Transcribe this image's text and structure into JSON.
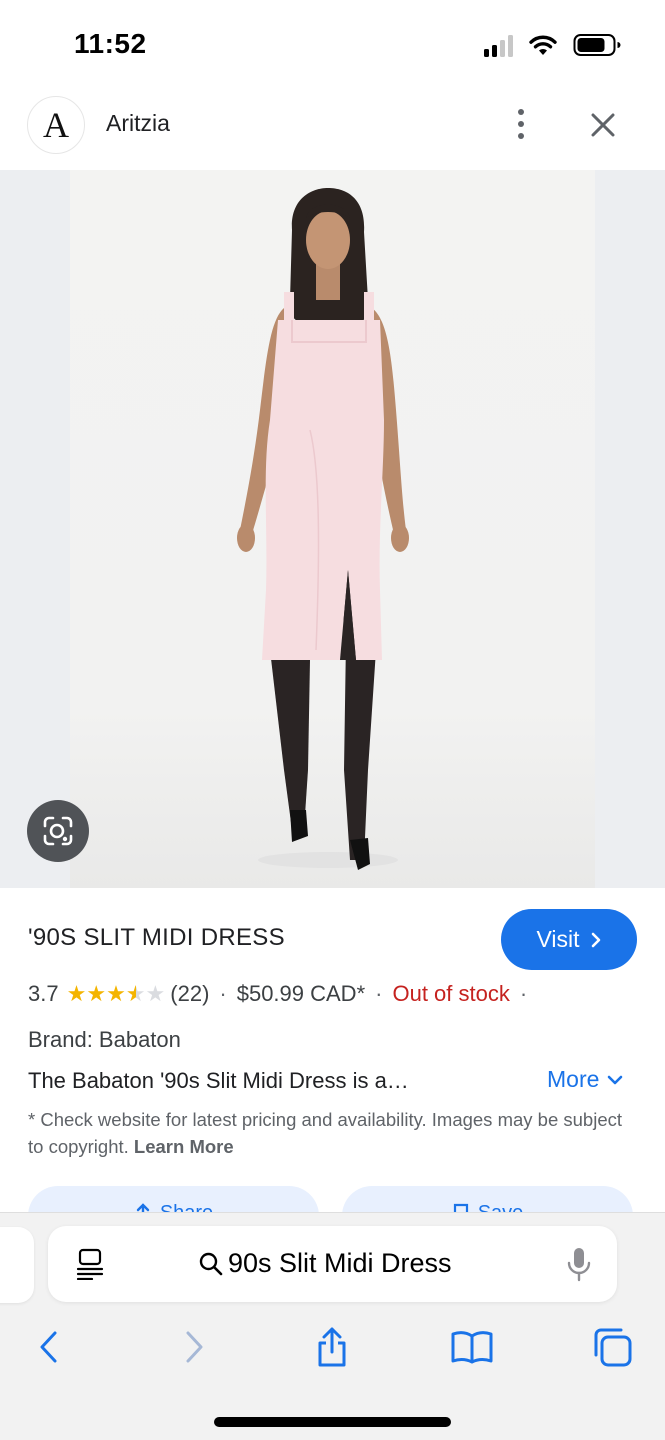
{
  "status_bar": {
    "time": "11:52",
    "signal_bars": 2,
    "battery_percent": 75
  },
  "header": {
    "logo_letter": "A",
    "site_name": "Aritzia"
  },
  "product": {
    "title": "'90S SLIT MIDI DRESS",
    "visit_label": "Visit",
    "rating_value": "3.7",
    "rating_stars": 3.7,
    "review_count": "(22)",
    "price": "$50.99 CAD*",
    "stock_status": "Out of stock",
    "brand": "Brand: Babaton",
    "description": "The Babaton '90s Slit Midi Dress is a…",
    "more_label": "More",
    "disclaimer": "* Check website for latest pricing and availability. Images may be subject to copyright.",
    "learn_more": "Learn More",
    "share_label": "Share",
    "save_label": "Save"
  },
  "browser": {
    "url_text": "90s Slit Midi Dress"
  },
  "colors": {
    "accent": "#1a73e8",
    "out_of_stock": "#c5221f",
    "star": "#f4b400",
    "dress": "#f6dde0"
  },
  "icons": [
    "wifi-icon",
    "battery-icon",
    "more-vert-icon",
    "close-icon",
    "google-lens-icon",
    "chevron-right-icon",
    "chevron-down-icon",
    "share-icon",
    "bookmark-icon",
    "reader-icon",
    "search-icon",
    "mic-icon",
    "back-icon",
    "forward-icon",
    "share-icon",
    "bookmarks-icon",
    "tabs-icon"
  ]
}
